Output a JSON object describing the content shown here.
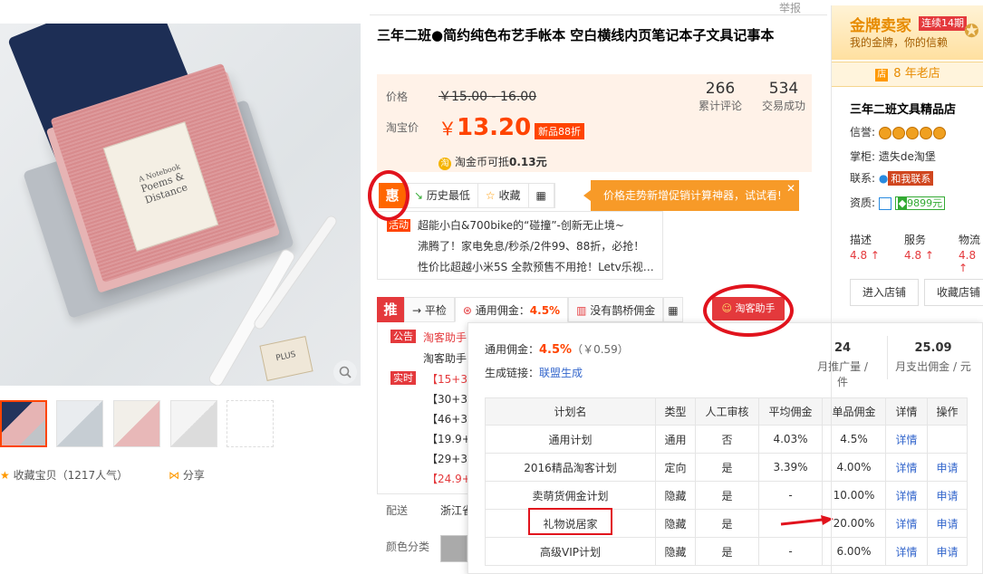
{
  "report_link": "举报",
  "product": {
    "title": "三年二班●简约纯色布艺手帐本 空白横线内页笔记本子文具记事本",
    "cover_title": "Poems & Distance",
    "cover_prefix": "A Notebook",
    "eraser_text": "PLUS"
  },
  "gallery": {
    "favorite_label": "收藏宝贝（1217人气）",
    "share_label": "分享"
  },
  "price": {
    "label": "价格",
    "original": "￥15.00 - 16.00",
    "taobao_label": "淘宝价",
    "currency": "￥",
    "current": "13.20",
    "discount_badge": "新品88折",
    "coin_icon": "淘",
    "coin_text": "淘金币可抵",
    "coin_value": "0.13元",
    "reviews_count": "266",
    "reviews_label": "累计评论",
    "deals_count": "534",
    "deals_label": "交易成功"
  },
  "toolbar": {
    "hui_label": "惠",
    "history_low": "历史最低",
    "favorite": "收藏",
    "qrcode_icon": "qrcode-icon",
    "promo_text": "价格走势新增促销计算神器，试试看!",
    "promo_close": "✕"
  },
  "activity": {
    "tag": "活动",
    "lines": [
      "超能小白&700bike的“碰撞”-创新无止境~",
      "沸腾了！家电免息/秒杀/2件99、88折，必抢！",
      "性价比超越小米5S 全款预售不用抢！Letv乐视…"
    ]
  },
  "tabs": {
    "tui_label": "推",
    "ping_label": "平检",
    "general_label": "通用佣金：",
    "general_pct": "4.5%",
    "queqiao_label": "没有鹊桥佣金",
    "helper_label": "淘客助手"
  },
  "left_info": {
    "notice_tag": "公告",
    "notice_lines": [
      "淘客助手",
      "淘客助手"
    ],
    "realtime_tag": "实时",
    "realtime_lines": [
      "【15+30",
      "【30+30",
      "【46+30",
      "【19.9+",
      "【29+30",
      "【24.9+"
    ]
  },
  "delivery": {
    "label": "配送",
    "value": "浙江省"
  },
  "color": {
    "label": "颜色分类"
  },
  "panel": {
    "commission_label": "通用佣金：",
    "commission_pct": "4.5%",
    "commission_amt": "（￥0.59）",
    "gen_label": "生成链接：",
    "gen_link": "联盟生成",
    "stat1_value": "24",
    "stat1_label": "月推广量 / 件",
    "stat2_value": "25.09",
    "stat2_label": "月支出佣金 / 元",
    "columns": [
      "计划名",
      "类型",
      "人工审核",
      "平均佣金",
      "单品佣金",
      "详情",
      "操作"
    ],
    "rows": [
      [
        "通用计划",
        "通用",
        "否",
        "4.03%",
        "4.5%",
        "详情",
        ""
      ],
      [
        "2016精品淘客计划",
        "定向",
        "是",
        "3.39%",
        "4.00%",
        "详情",
        "申请"
      ],
      [
        "卖萌货佣金计划",
        "隐藏",
        "是",
        "-",
        "10.00%",
        "详情",
        "申请"
      ],
      [
        "礼物说居家",
        "隐藏",
        "是",
        "-",
        "20.00%",
        "详情",
        "申请"
      ],
      [
        "高级VIP计划",
        "隐藏",
        "是",
        "-",
        "6.00%",
        "详情",
        "申请"
      ]
    ]
  },
  "seller": {
    "gold_title": "金牌卖家",
    "gold_badge": "连续14期",
    "gold_sub": "我的金牌，你的信赖",
    "years_icon": "店",
    "years_text": "8 年老店",
    "shop_name": "三年二班文具精品店",
    "credit_label": "信誉:",
    "keeper_label": "掌柜:",
    "keeper_name": "遗失de淘堡",
    "contact_label": "联系:",
    "contact_btn": "和我联系",
    "qualify_label": "资质:",
    "deposit": "9899元",
    "ratings": [
      {
        "label": "描述",
        "value": "4.8 ↑"
      },
      {
        "label": "服务",
        "value": "4.8 ↑"
      },
      {
        "label": "物流",
        "value": "4.8 ↑"
      }
    ],
    "enter_shop": "进入店铺",
    "fav_shop": "收藏店铺"
  },
  "colors": {
    "accent": "#ff4400",
    "annotation": "#e1131d",
    "link": "#3366cc"
  }
}
